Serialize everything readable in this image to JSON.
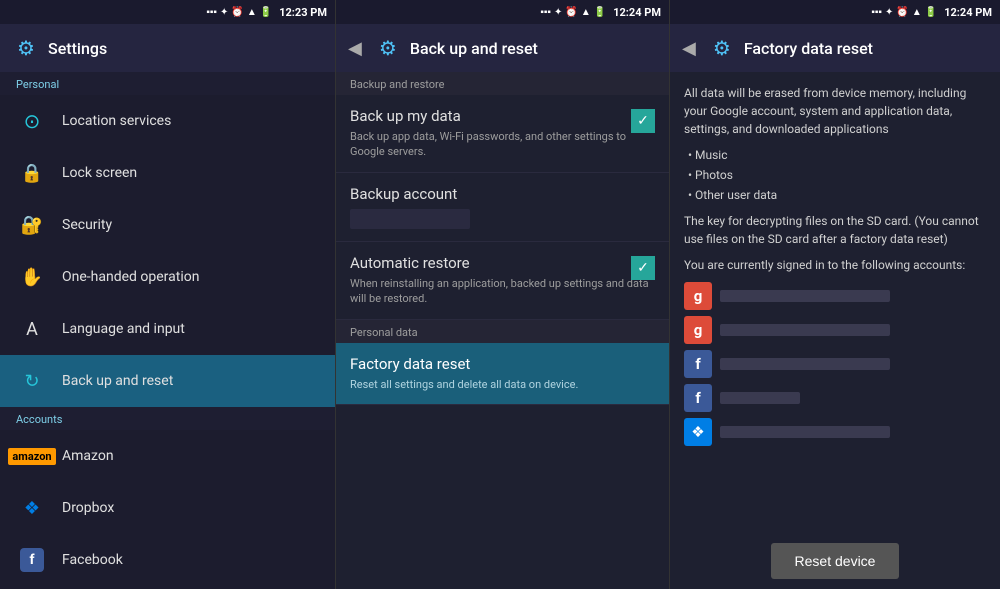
{
  "panels": {
    "left": {
      "statusBar": {
        "time": "12:23 PM"
      },
      "topBar": {
        "icon": "⚙",
        "title": "Settings"
      },
      "sections": [
        {
          "label": "Personal",
          "items": [
            {
              "id": "location-services",
              "icon": "location",
              "label": "Location services"
            },
            {
              "id": "lock-screen",
              "icon": "lock",
              "label": "Lock screen"
            },
            {
              "id": "security",
              "icon": "security",
              "label": "Security"
            },
            {
              "id": "one-handed",
              "icon": "hand",
              "label": "One-handed operation"
            },
            {
              "id": "language",
              "icon": "language",
              "label": "Language and input"
            },
            {
              "id": "backup",
              "icon": "backup",
              "label": "Back up and reset",
              "active": true
            }
          ]
        },
        {
          "label": "Accounts",
          "items": [
            {
              "id": "amazon",
              "icon": "amazon",
              "label": "Amazon"
            },
            {
              "id": "dropbox",
              "icon": "dropbox",
              "label": "Dropbox"
            },
            {
              "id": "facebook",
              "icon": "facebook",
              "label": "Facebook"
            }
          ]
        }
      ]
    },
    "mid": {
      "statusBar": {
        "time": "12:24 PM"
      },
      "topBar": {
        "title": "Back up and reset"
      },
      "backupRestoreLabel": "Backup and restore",
      "items": [
        {
          "id": "backup-my-data",
          "title": "Back up my data",
          "subtitle": "Back up app data, Wi-Fi passwords, and other settings to Google servers.",
          "checked": true
        },
        {
          "id": "backup-account",
          "title": "Backup account",
          "hasBar": true
        },
        {
          "id": "auto-restore",
          "title": "Automatic restore",
          "subtitle": "When reinstalling an application, backed up settings and data will be restored.",
          "checked": true
        }
      ],
      "personalDataLabel": "Personal data",
      "factoryReset": {
        "id": "factory-data-reset",
        "title": "Factory data reset",
        "subtitle": "Reset all settings and delete all data on device.",
        "active": true
      }
    },
    "right": {
      "statusBar": {
        "time": "12:24 PM"
      },
      "topBar": {
        "title": "Factory data reset"
      },
      "description": "All data will be erased from device memory, including your Google account, system and application data, settings, and downloaded applications",
      "bullets": [
        "• Music",
        "• Photos",
        "• Other user data"
      ],
      "sdCardNote": "The key for decrypting files on the SD card. (You cannot use files on the SD card after a factory data reset)",
      "accountsNote": "You are currently signed in to the following accounts:",
      "accounts": [
        {
          "type": "google",
          "id": "g1"
        },
        {
          "type": "google",
          "id": "g2"
        },
        {
          "type": "facebook",
          "id": "f1"
        },
        {
          "type": "facebook",
          "id": "f2"
        },
        {
          "type": "dropbox",
          "id": "db1"
        }
      ],
      "resetButton": "Reset device"
    }
  }
}
